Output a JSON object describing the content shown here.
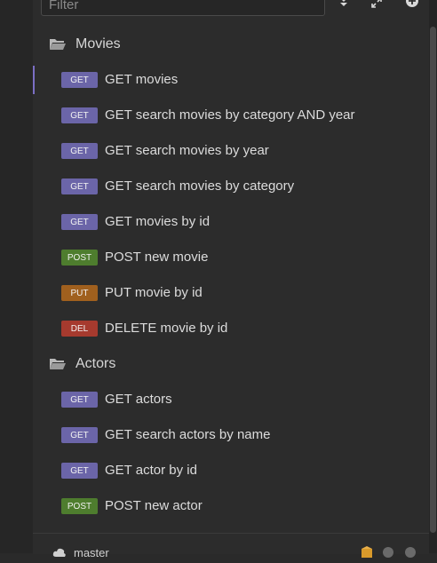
{
  "filter": {
    "placeholder": "Filter"
  },
  "toolbar": {
    "sort_icon": "sort-down-icon",
    "expand_icon": "expand-icon",
    "add_icon": "plus-circle-icon"
  },
  "colors": {
    "GET": "#6b65a8",
    "POST": "#4e7d2e",
    "PUT": "#a0601e",
    "DEL": "#a63a2e",
    "active": "#7b6fc4"
  },
  "folders": [
    {
      "name": "Movies",
      "requests": [
        {
          "method": "GET",
          "label": "GET movies",
          "active": true
        },
        {
          "method": "GET",
          "label": "GET search movies by category AND year"
        },
        {
          "method": "GET",
          "label": "GET search movies by year"
        },
        {
          "method": "GET",
          "label": "GET search movies by category"
        },
        {
          "method": "GET",
          "label": "GET movies by id"
        },
        {
          "method": "POST",
          "label": "POST new movie"
        },
        {
          "method": "PUT",
          "label": "PUT movie by id"
        },
        {
          "method": "DEL",
          "label": "DELETE movie by id"
        }
      ]
    },
    {
      "name": "Actors",
      "requests": [
        {
          "method": "GET",
          "label": "GET actors"
        },
        {
          "method": "GET",
          "label": "GET search actors by name"
        },
        {
          "method": "GET",
          "label": "GET actor by id"
        },
        {
          "method": "POST",
          "label": "POST new actor"
        }
      ]
    }
  ],
  "footer": {
    "branch": "master"
  }
}
